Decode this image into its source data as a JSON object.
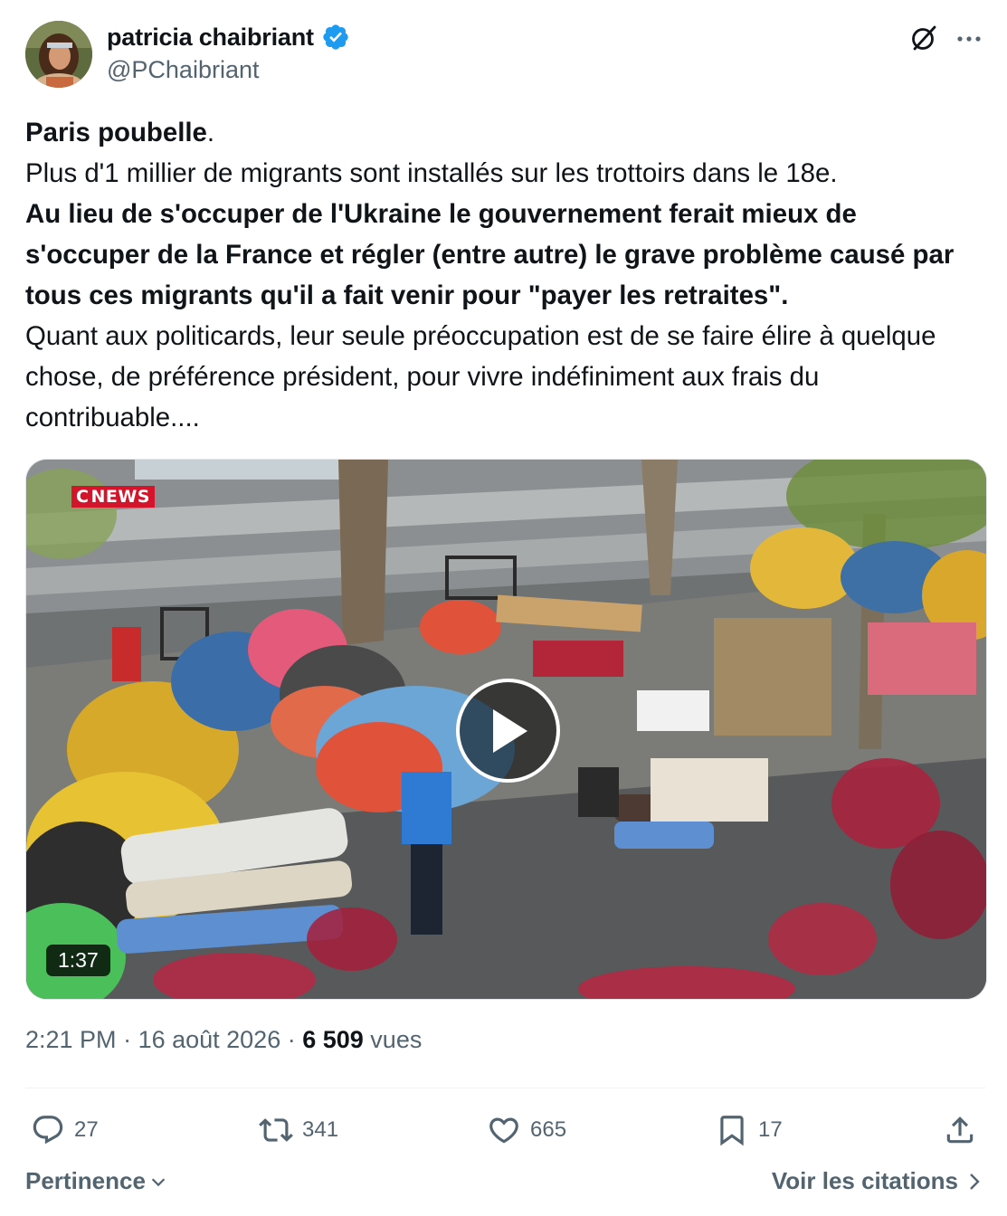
{
  "author": {
    "display_name": "patricia chaibriant",
    "handle": "@PChaibriant",
    "verified": true
  },
  "post": {
    "lines": [
      {
        "bold": "Paris poubelle",
        "normal": "."
      },
      {
        "normal": "Plus d'1 millier de migrants sont installés sur les trottoirs dans le 18e."
      },
      {
        "bold": "Au lieu de s'occuper de l'Ukraine le gouvernement ferait mieux de s'occuper de la France et régler (entre autre) le grave problème causé par tous ces migrants qu'il a fait venir pour \"payer les retraites\"."
      },
      {
        "normal": "Quant aux politicards, leur seule préoccupation est de se faire élire à quelque chose, de préférence président, pour vivre indéfiniment aux frais du contribuable...."
      }
    ]
  },
  "media": {
    "channel_logo": "NEWS",
    "duration": "1:37"
  },
  "meta": {
    "time": "2:21 PM",
    "separator": " · ",
    "date": "16 août 2026",
    "views": "6 509",
    "views_label": " vues"
  },
  "actions": {
    "replies": "27",
    "reposts": "341",
    "likes": "665",
    "bookmarks": "17"
  },
  "footer": {
    "sort_label": "Pertinence",
    "quotes_label": "Voir les citations"
  },
  "colors": {
    "text": "#0f1419",
    "secondary": "#536471",
    "verified": "#1d9bf0",
    "channel_red": "#d3142b"
  }
}
